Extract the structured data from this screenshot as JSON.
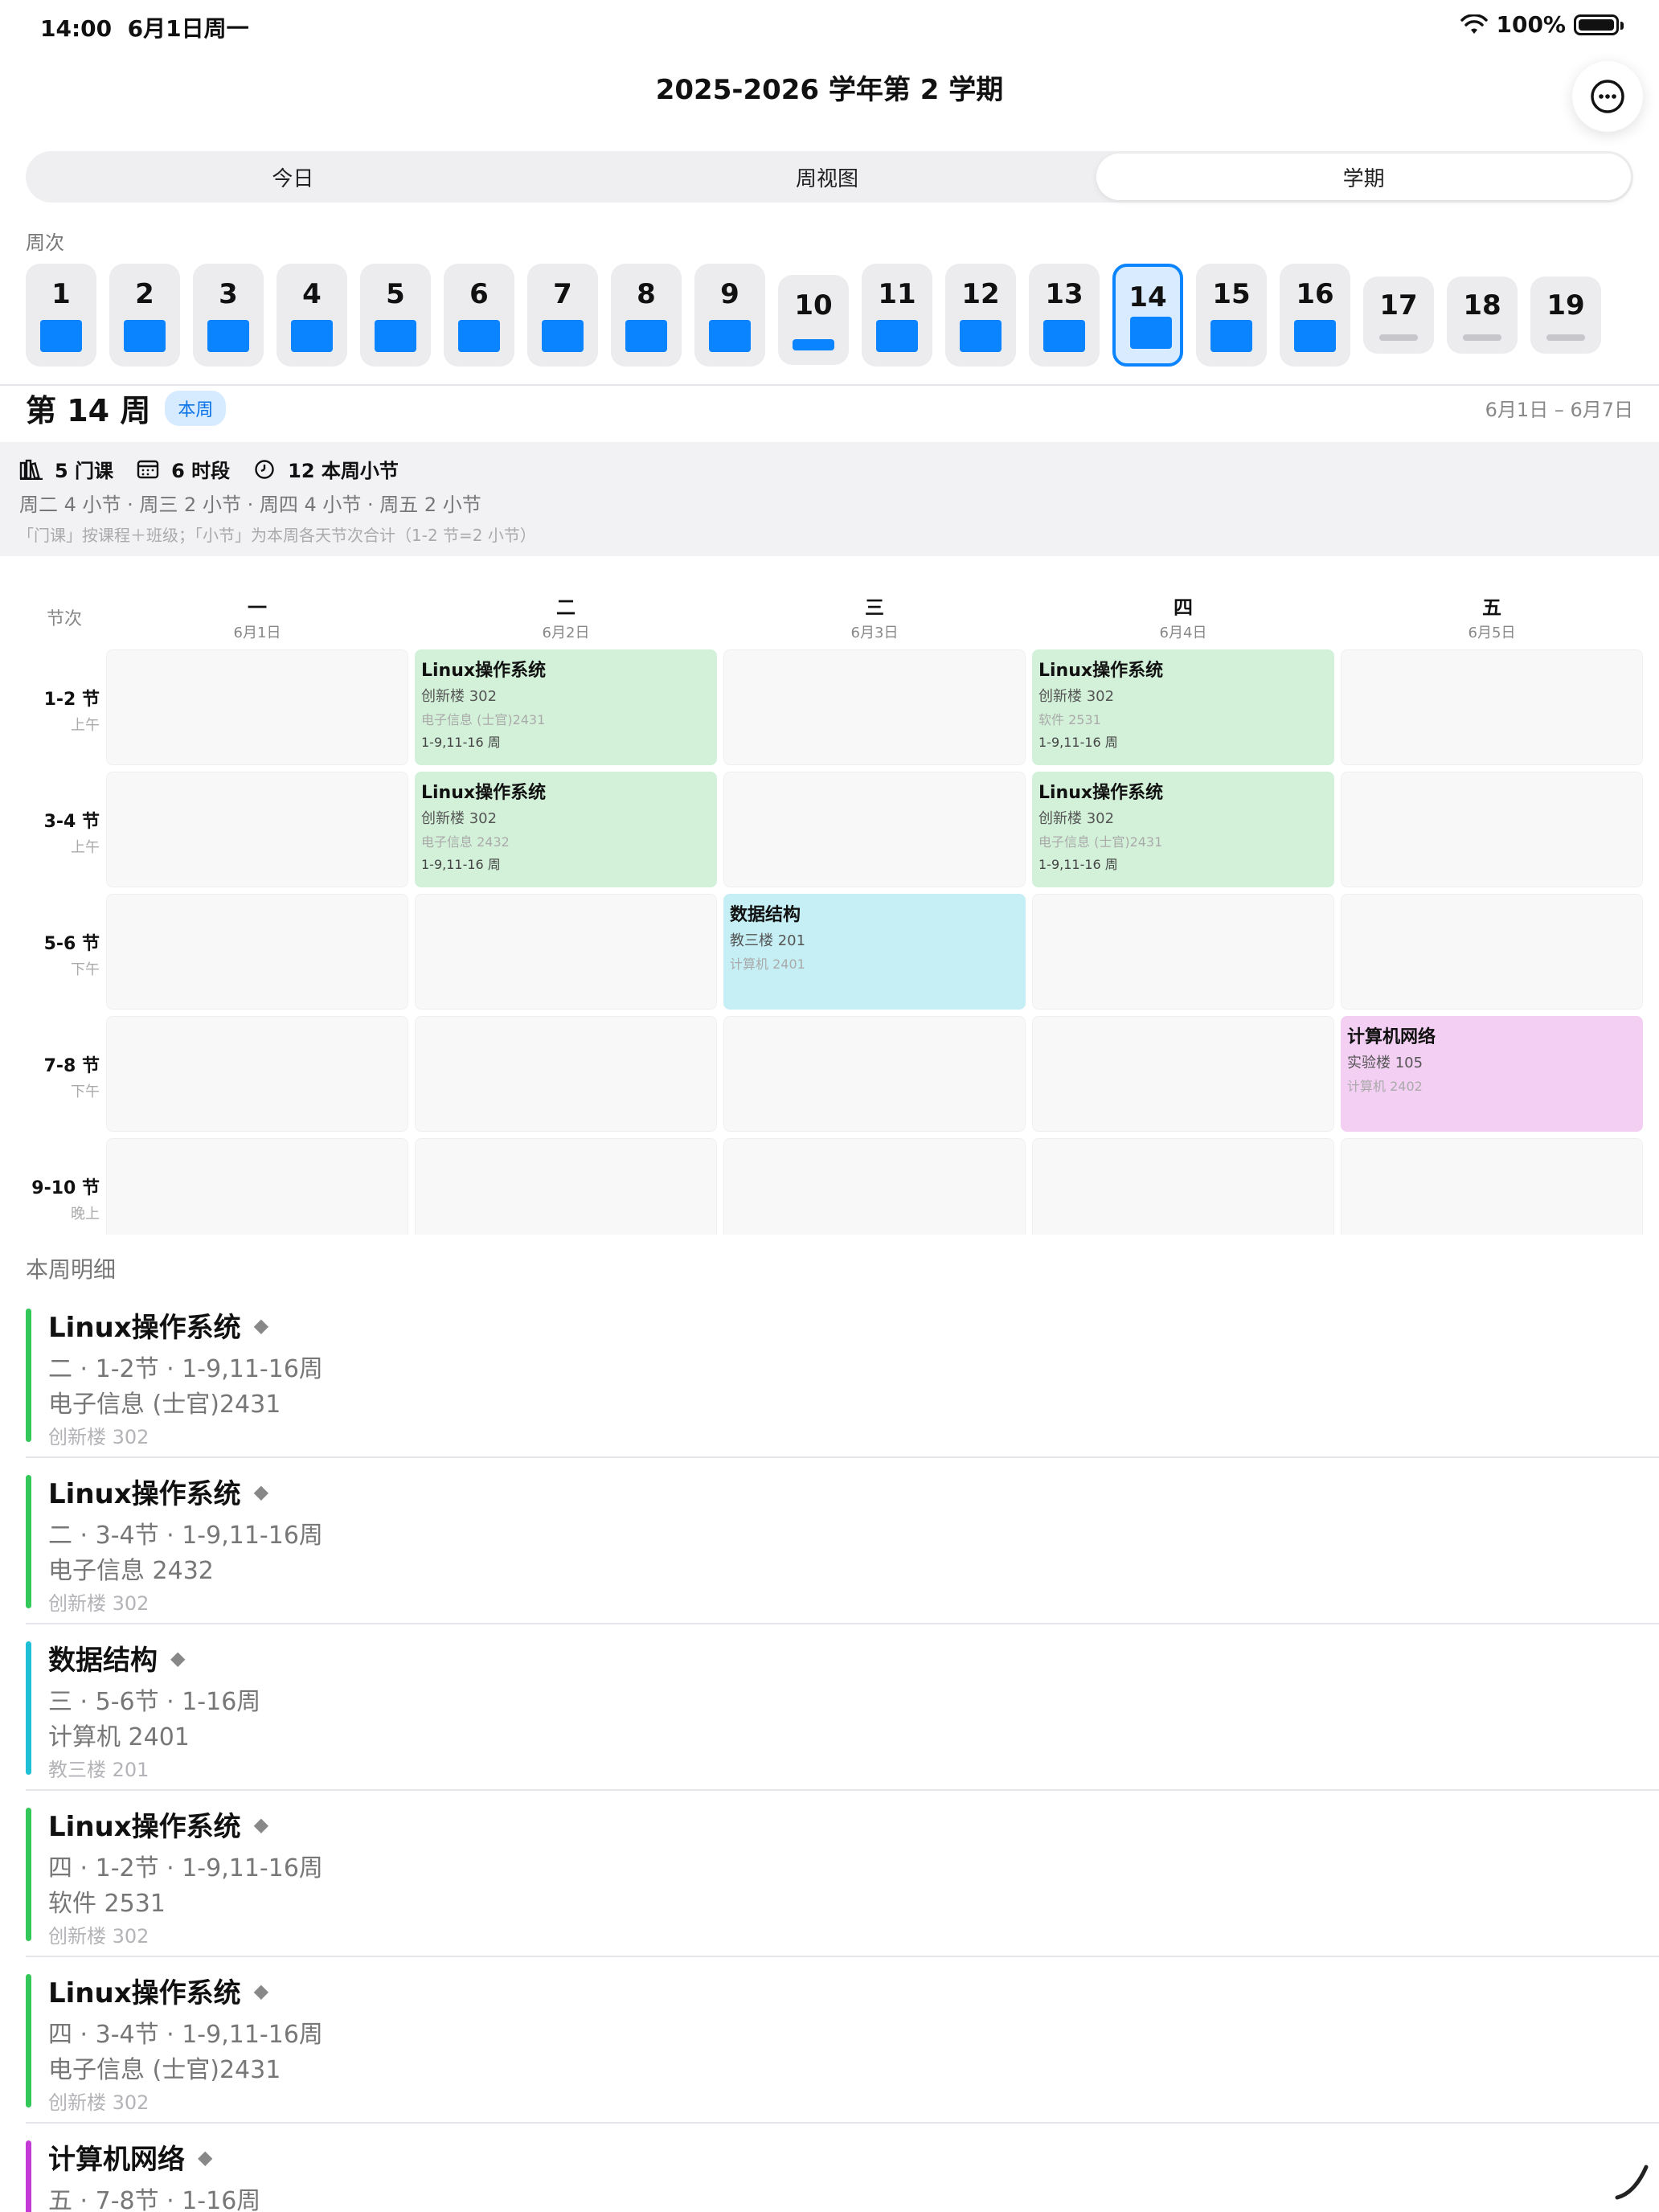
{
  "status": {
    "time": "14:00",
    "date": "6月1日周一",
    "battery": "100%"
  },
  "title": "2025-2026 学年第 2 学期",
  "tabs": [
    {
      "label": "今日"
    },
    {
      "label": "周视图"
    },
    {
      "label": "学期"
    }
  ],
  "weeks_label": "周次",
  "weeks": [
    {
      "n": "1",
      "fill": "full"
    },
    {
      "n": "2",
      "fill": "full"
    },
    {
      "n": "3",
      "fill": "full"
    },
    {
      "n": "4",
      "fill": "full"
    },
    {
      "n": "5",
      "fill": "full"
    },
    {
      "n": "6",
      "fill": "full"
    },
    {
      "n": "7",
      "fill": "full"
    },
    {
      "n": "8",
      "fill": "full"
    },
    {
      "n": "9",
      "fill": "full"
    },
    {
      "n": "10",
      "fill": "partial"
    },
    {
      "n": "11",
      "fill": "full"
    },
    {
      "n": "12",
      "fill": "full"
    },
    {
      "n": "13",
      "fill": "full"
    },
    {
      "n": "14",
      "fill": "full",
      "selected": true
    },
    {
      "n": "15",
      "fill": "full"
    },
    {
      "n": "16",
      "fill": "full"
    },
    {
      "n": "17",
      "fill": "none"
    },
    {
      "n": "18",
      "fill": "none"
    },
    {
      "n": "19",
      "fill": "none"
    }
  ],
  "week_header": {
    "title": "第 14 周",
    "badge": "本周",
    "range": "6月1日 – 6月7日"
  },
  "summary": {
    "courses": "5 门课",
    "slots": "6 时段",
    "periods": "12 本周小节",
    "detail": "周二 4 小节 · 周三 2 小节 · 周四 4 小节 · 周五 2 小节",
    "note": "「门课」按课程＋班级；「小节」为本周各天节次合计（1-2 节=2 小节）"
  },
  "timetable": {
    "corner": "节次",
    "days": [
      {
        "label": "一",
        "date": "6月1日"
      },
      {
        "label": "二",
        "date": "6月2日"
      },
      {
        "label": "三",
        "date": "6月3日"
      },
      {
        "label": "四",
        "date": "6月4日"
      },
      {
        "label": "五",
        "date": "6月5日"
      }
    ],
    "periods": [
      {
        "label": "1-2 节",
        "time": "上午"
      },
      {
        "label": "3-4 节",
        "time": "上午"
      },
      {
        "label": "5-6 节",
        "time": "下午"
      },
      {
        "label": "7-8 节",
        "time": "下午"
      },
      {
        "label": "9-10 节",
        "time": "晚上"
      }
    ],
    "courses": [
      {
        "day": 1,
        "period": 0,
        "color": "green",
        "name": "Linux操作系统",
        "room": "创新楼 302",
        "cls": "电子信息 (士官)2431",
        "weeks": "1-9,11-16 周"
      },
      {
        "day": 3,
        "period": 0,
        "color": "green",
        "name": "Linux操作系统",
        "room": "创新楼 302",
        "cls": "软件 2531",
        "weeks": "1-9,11-16 周"
      },
      {
        "day": 1,
        "period": 1,
        "color": "green",
        "name": "Linux操作系统",
        "room": "创新楼 302",
        "cls": "电子信息 2432",
        "weeks": "1-9,11-16 周"
      },
      {
        "day": 3,
        "period": 1,
        "color": "green",
        "name": "Linux操作系统",
        "room": "创新楼 302",
        "cls": "电子信息 (士官)2431",
        "weeks": "1-9,11-16 周"
      },
      {
        "day": 2,
        "period": 2,
        "color": "cyan",
        "name": "数据结构",
        "room": "教三楼 201",
        "cls": "计算机 2401",
        "weeks": ""
      },
      {
        "day": 4,
        "period": 3,
        "color": "pink",
        "name": "计算机网络",
        "room": "实验楼 105",
        "cls": "计算机 2402",
        "weeks": ""
      }
    ]
  },
  "details_label": "本周明细",
  "details": [
    {
      "name": "Linux操作系统",
      "color": "#34c759",
      "when": "二 · 1-2节 · 1-9,11-16周",
      "cls": "电子信息 (士官)2431",
      "room": "创新楼 302"
    },
    {
      "name": "Linux操作系统",
      "color": "#34c759",
      "when": "二 · 3-4节 · 1-9,11-16周",
      "cls": "电子信息 2432",
      "room": "创新楼 302"
    },
    {
      "name": "数据结构",
      "color": "#1fbfd6",
      "when": "三 · 5-6节 · 1-16周",
      "cls": "计算机 2401",
      "room": "教三楼 201"
    },
    {
      "name": "Linux操作系统",
      "color": "#34c759",
      "when": "四 · 1-2节 · 1-9,11-16周",
      "cls": "软件 2531",
      "room": "创新楼 302"
    },
    {
      "name": "Linux操作系统",
      "color": "#34c759",
      "when": "四 · 3-4节 · 1-9,11-16周",
      "cls": "电子信息 (士官)2431",
      "room": "创新楼 302"
    },
    {
      "name": "计算机网络",
      "color": "#c33ad6",
      "when": "五 · 7-8节 · 1-16周",
      "cls": "",
      "room": ""
    }
  ]
}
